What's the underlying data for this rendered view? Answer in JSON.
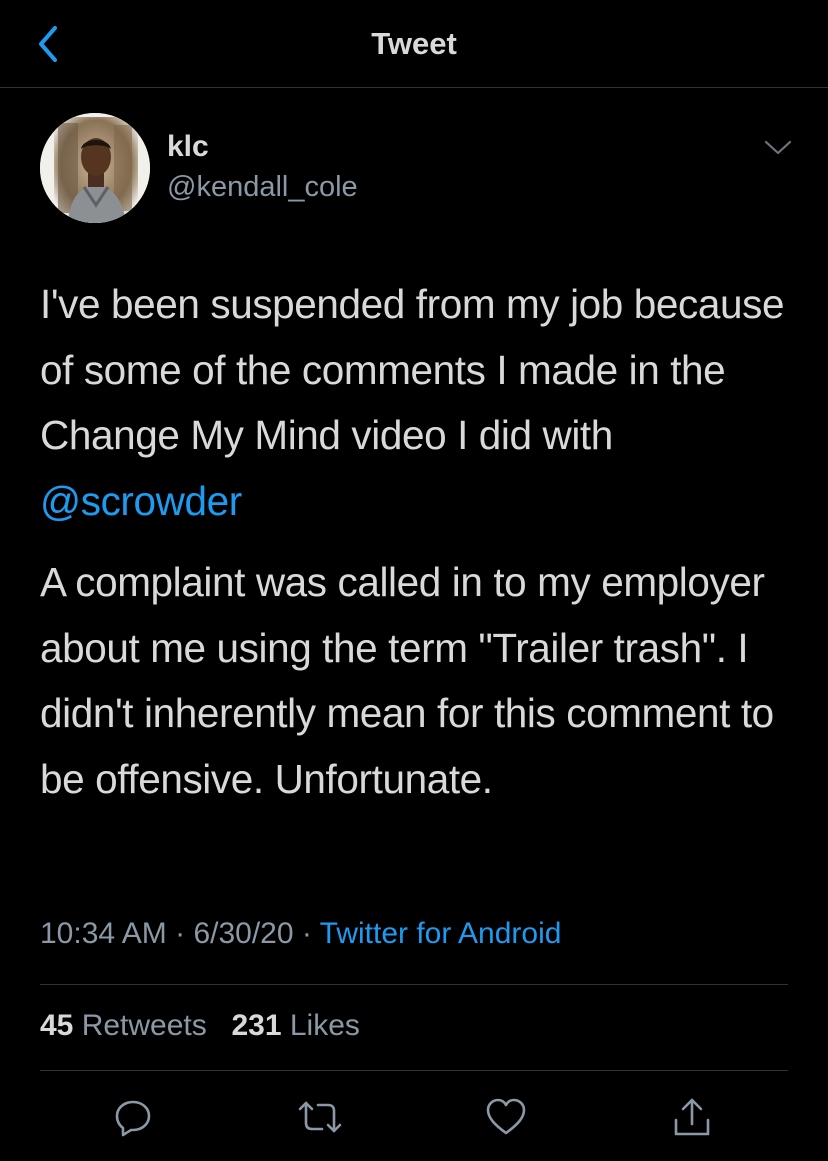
{
  "header": {
    "title": "Tweet",
    "back_icon": "chevron-left-icon"
  },
  "author": {
    "display_name": "klc",
    "handle": "@kendall_cole",
    "avatar": "profile-photo"
  },
  "tweet": {
    "paragraph1_text": "I've been suspended from my job because of some of the comments I made in the Change My Mind video I did with ",
    "mention": "@scrowder",
    "paragraph2_text": "A complaint was called in to my employer about me using the term \"Trailer trash\". I didn't inherently mean for this comment to be offensive. Unfortunate."
  },
  "meta": {
    "time": "10:34 AM",
    "separator": " · ",
    "date": "6/30/20",
    "source": "Twitter for Android"
  },
  "stats": {
    "retweets_count": "45",
    "retweets_label": " Retweets",
    "likes_count": "231",
    "likes_label": " Likes"
  },
  "actions": {
    "reply_icon": "reply-icon",
    "retweet_icon": "retweet-icon",
    "like_icon": "heart-icon",
    "share_icon": "share-icon"
  },
  "colors": {
    "background": "#000000",
    "text_primary": "#d9d9d9",
    "text_secondary": "#8b98a5",
    "accent": "#1d9bf0",
    "divider": "#2f3336"
  }
}
